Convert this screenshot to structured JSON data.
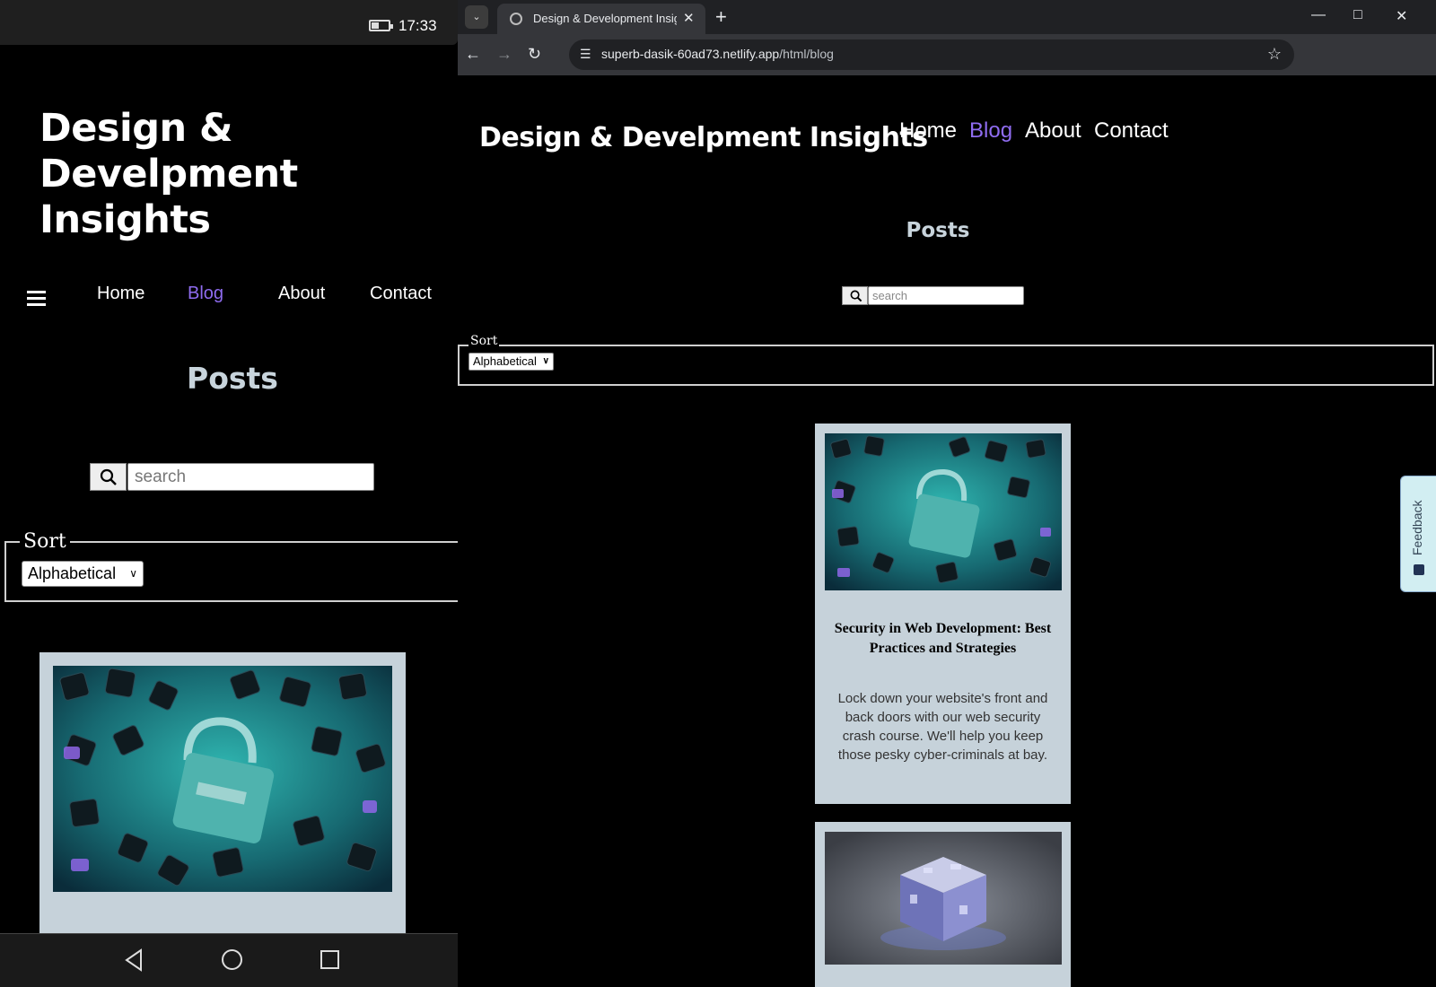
{
  "phone": {
    "status": {
      "time": "17:33"
    },
    "site_title": "Design & Develpment Insights",
    "nav": {
      "home": "Home",
      "blog": "Blog",
      "about": "About",
      "contact": "Contact"
    },
    "posts_heading": "Posts",
    "search_placeholder": "search",
    "sort_legend": "Sort",
    "sort_selected": "Alphabetical"
  },
  "browser": {
    "tab_title": "Design & Development Insights",
    "url_host": "superb-dasik-60ad73.netlify.app",
    "url_path": "/html/blog",
    "page": {
      "site_title": "Design & Develpment Insights",
      "nav": {
        "home": "Home",
        "blog": "Blog",
        "about": "About",
        "contact": "Contact"
      },
      "posts_heading": "Posts",
      "search_placeholder": "search",
      "sort_legend": "Sort",
      "sort_selected": "Alphabetical",
      "posts": [
        {
          "title": "Security in Web Development: Best Practices and Strategies",
          "description": "Lock down your website's front and back doors with our web security crash course. We'll help you keep those pesky cyber-criminals at bay."
        }
      ],
      "feedback_label": "Feedback"
    }
  },
  "colors": {
    "accent": "#8f6cf0",
    "card_bg": "#c6d2da",
    "page_bg": "#000000"
  }
}
